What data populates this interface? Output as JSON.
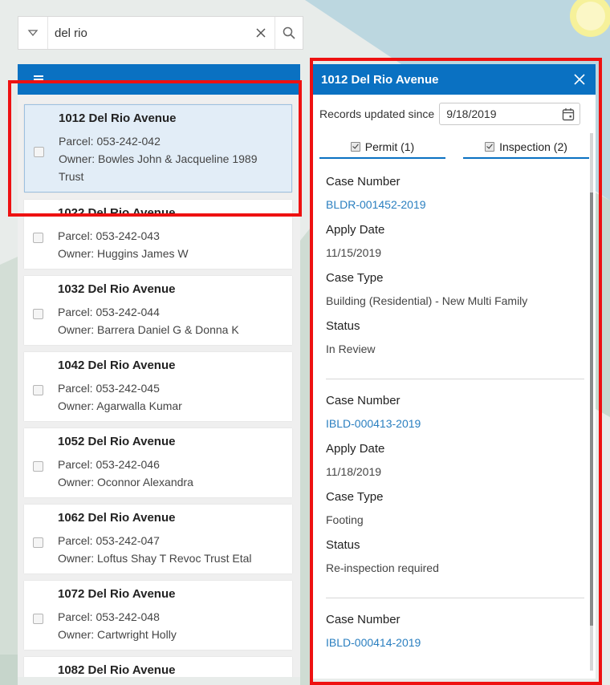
{
  "search": {
    "value": "del rio"
  },
  "results": [
    {
      "address": "1012 Del Rio Avenue",
      "parcel": "Parcel: 053-242-042",
      "owner": "Owner: Bowles John & Jacqueline 1989",
      "owner_cont": "Trust",
      "selected": true
    },
    {
      "address": "1022 Del Rio Avenue",
      "parcel": "Parcel: 053-242-043",
      "owner": "Owner: Huggins James W"
    },
    {
      "address": "1032 Del Rio Avenue",
      "parcel": "Parcel: 053-242-044",
      "owner": "Owner: Barrera Daniel G & Donna K"
    },
    {
      "address": "1042 Del Rio Avenue",
      "parcel": "Parcel: 053-242-045",
      "owner": "Owner: Agarwalla Kumar"
    },
    {
      "address": "1052 Del Rio Avenue",
      "parcel": "Parcel: 053-242-046",
      "owner": "Owner: Oconnor Alexandra"
    },
    {
      "address": "1062 Del Rio Avenue",
      "parcel": "Parcel: 053-242-047",
      "owner": "Owner: Loftus Shay T Revoc Trust Etal"
    },
    {
      "address": "1072 Del Rio Avenue",
      "parcel": "Parcel: 053-242-048",
      "owner": "Owner: Cartwright Holly"
    },
    {
      "address": "1082 Del Rio Avenue"
    }
  ],
  "detail": {
    "title": "1012 Del Rio Avenue",
    "since_label": "Records updated since",
    "since_date": "9/18/2019",
    "tabs": [
      {
        "label": "Permit (1)",
        "checked": true
      },
      {
        "label": "Inspection (2)",
        "checked": true
      }
    ],
    "labels": {
      "case_number": "Case Number",
      "apply_date": "Apply Date",
      "case_type": "Case Type",
      "status": "Status"
    },
    "records": [
      {
        "case_number": "BLDR-001452-2019",
        "apply_date": "11/15/2019",
        "case_type": "Building (Residential) - New Multi Family",
        "status": "In Review"
      },
      {
        "case_number": "IBLD-000413-2019",
        "apply_date": "11/18/2019",
        "case_type": "Footing",
        "status": "Re-inspection required"
      },
      {
        "case_number": "IBLD-000414-2019"
      }
    ]
  },
  "colors": {
    "accent": "#0a71c2",
    "highlight": "#ee1111",
    "link": "#2a7fc0"
  },
  "icons": {
    "search_toggle": "triangle-down-icon",
    "clear": "close-icon",
    "search": "search-icon",
    "menu": "menu-icon",
    "close": "close-icon",
    "calendar": "calendar-icon"
  }
}
